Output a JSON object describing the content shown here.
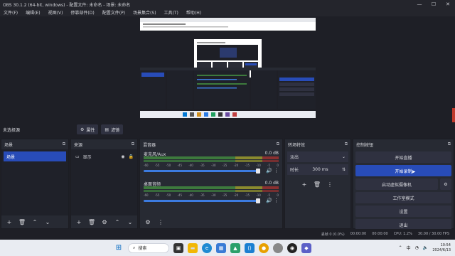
{
  "window": {
    "title": "OBS 30.1.2 (64-bit, windows) - 配置文件: 未命名 - 场景: 未命名",
    "controls": [
      "—",
      "☐",
      "✕"
    ]
  },
  "menu": [
    "文件(F)",
    "编辑(E)",
    "视图(V)",
    "停靠部件(D)",
    "配置文件(P)",
    "场景集合(S)",
    "工具(T)",
    "帮助(H)"
  ],
  "toolbar": {
    "current_scene": "未选择源",
    "properties_label": "属性",
    "filters_label": "滤镜"
  },
  "docks": {
    "scenes": {
      "title": "场景",
      "items": [
        "场景"
      ]
    },
    "sources": {
      "title": "来源",
      "items": [
        {
          "name": "显示"
        }
      ]
    },
    "mixer": {
      "title": "混音器",
      "channels": [
        {
          "name": "麦克风/Aux",
          "db": "0.0 dB"
        },
        {
          "name": "桌面音频",
          "db": "0.0 dB"
        }
      ],
      "ticks": [
        "-60",
        "-55",
        "-50",
        "-45",
        "-40",
        "-35",
        "-30",
        "-25",
        "-20",
        "-15",
        "-10",
        "-5",
        "0"
      ]
    },
    "transitions": {
      "title": "转场特效",
      "type": "淡出",
      "duration_label": "时长",
      "duration_value": "300 ms"
    },
    "controls": {
      "title": "控制按钮",
      "buttons": [
        "开始直播",
        "开始录制",
        "启动虚拟摄像机",
        "工作室模式",
        "设置",
        "退出"
      ]
    }
  },
  "status": {
    "dropped": "丢帧 0 (0.0%)",
    "cpu": "CPU: 1.2%",
    "fps": "30.00 / 30.00 FPS",
    "time1": "00:00:00",
    "time2": "00:00:00"
  },
  "taskbar": {
    "search": "搜索",
    "lang": "中",
    "time": "10:54",
    "date": "2024/6/13"
  }
}
